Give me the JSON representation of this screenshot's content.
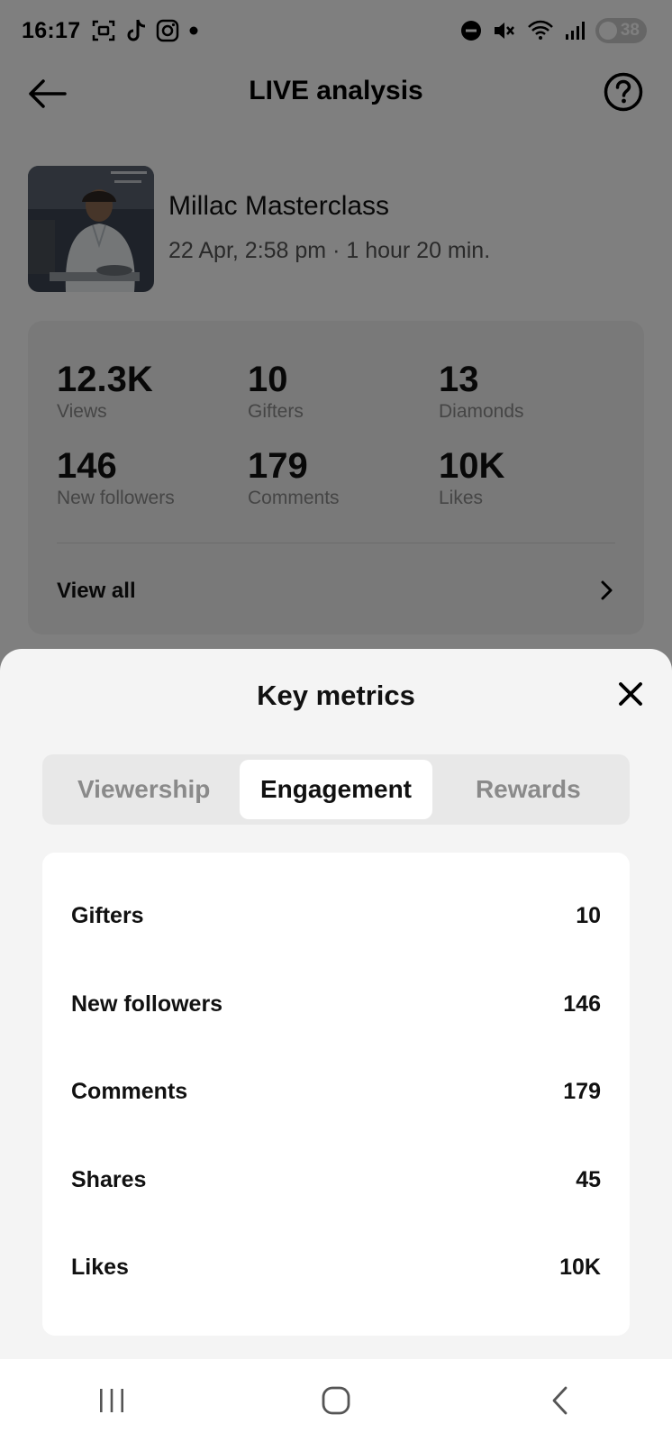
{
  "status_bar": {
    "time": "16:17",
    "battery": "38",
    "left_icons": [
      "screenshot-icon",
      "tiktok-icon",
      "instagram-icon",
      "notification-dot-icon"
    ],
    "right_icons": [
      "do-not-disturb-icon",
      "mute-icon",
      "wifi-icon",
      "signal-icon",
      "battery-icon"
    ]
  },
  "header": {
    "title": "LIVE analysis",
    "back_icon": "arrow-left-icon",
    "help_icon": "help-circle-icon"
  },
  "live": {
    "title": "Millac Masterclass",
    "meta": "22 Apr, 2:58 pm · 1 hour 20 min."
  },
  "stats": {
    "items": [
      {
        "value": "12.3K",
        "label": "Views"
      },
      {
        "value": "10",
        "label": "Gifters"
      },
      {
        "value": "13",
        "label": "Diamonds"
      },
      {
        "value": "146",
        "label": "New followers"
      },
      {
        "value": "179",
        "label": "Comments"
      },
      {
        "value": "10K",
        "label": "Likes"
      }
    ],
    "view_all": "View all"
  },
  "sheet": {
    "title": "Key metrics",
    "tabs": [
      {
        "label": "Viewership",
        "active": false
      },
      {
        "label": "Engagement",
        "active": true
      },
      {
        "label": "Rewards",
        "active": false
      }
    ],
    "metrics": [
      {
        "label": "Gifters",
        "value": "10"
      },
      {
        "label": "New followers",
        "value": "146"
      },
      {
        "label": "Comments",
        "value": "179"
      },
      {
        "label": "Shares",
        "value": "45"
      },
      {
        "label": "Likes",
        "value": "10K"
      }
    ]
  },
  "nav": {
    "buttons": [
      "recent-apps-icon",
      "home-icon",
      "back-icon"
    ]
  },
  "colors": {
    "overlay": "rgba(0,0,0,0.5)",
    "sheet_bg": "#f4f4f4",
    "card_bg": "#ffffff",
    "muted_text": "#8a8a8a"
  }
}
